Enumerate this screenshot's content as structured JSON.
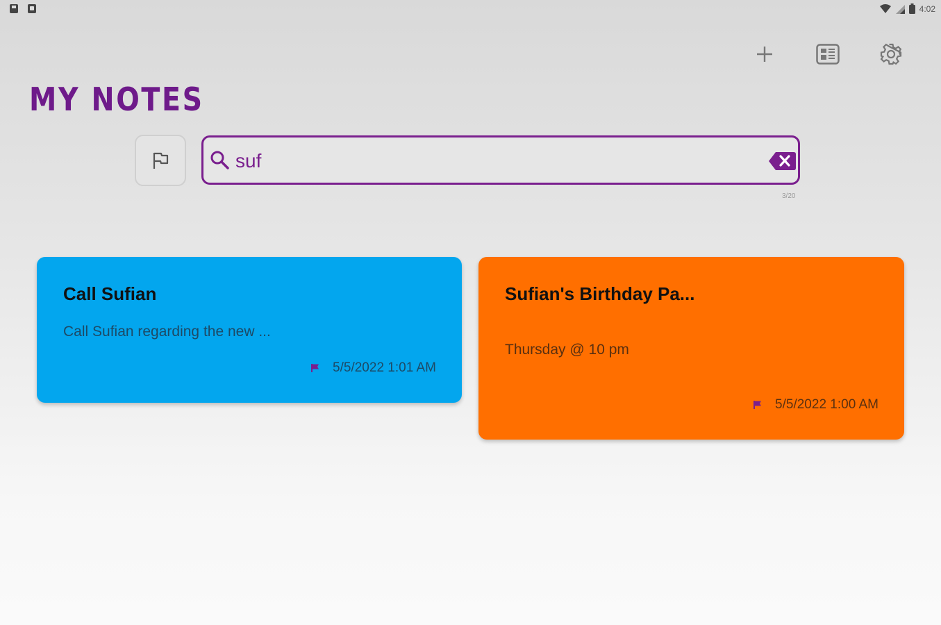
{
  "status_bar": {
    "time": "4:02"
  },
  "toolbar": {
    "add_icon": "plus-icon",
    "layout_icon": "grid-layout-icon",
    "settings_icon": "gear-icon"
  },
  "header": {
    "title": "MY NOTES"
  },
  "search": {
    "value": "suf",
    "counter": "3/20"
  },
  "notes": [
    {
      "title": "Call Sufian",
      "body": "Call Sufian regarding the new ...",
      "date": "5/5/2022 1:01 AM",
      "color": "#03a6ee",
      "flag_color": "#7a1f8e"
    },
    {
      "title": "Sufian's Birthday Pa...",
      "body": "Thursday @ 10 pm",
      "date": "5/5/2022 1:00 AM",
      "color": "#ff6f00",
      "flag_color": "#7a1f8e"
    }
  ],
  "colors": {
    "accent": "#7a1f8e",
    "title": "#6e1a8a"
  }
}
